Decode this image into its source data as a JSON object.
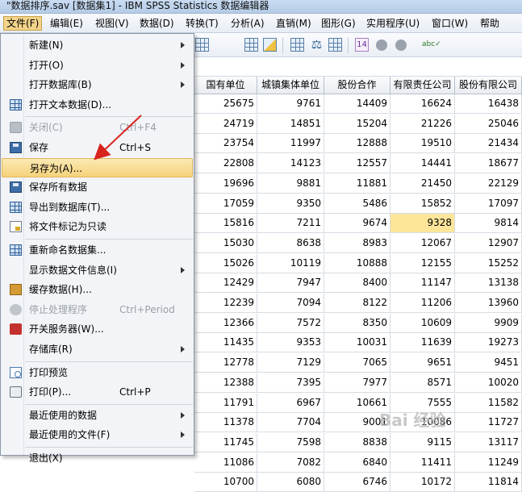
{
  "window": {
    "title": "\"数据排序.sav [数据集1] - IBM SPSS Statistics 数据编辑器"
  },
  "menubar": [
    {
      "label": "文件(F)",
      "active": true
    },
    {
      "label": "编辑(E)"
    },
    {
      "label": "视图(V)"
    },
    {
      "label": "数据(D)"
    },
    {
      "label": "转换(T)"
    },
    {
      "label": "分析(A)"
    },
    {
      "label": "直销(M)"
    },
    {
      "label": "图形(G)"
    },
    {
      "label": "实用程序(U)"
    },
    {
      "label": "窗口(W)"
    },
    {
      "label": "帮助"
    }
  ],
  "file_menu": [
    {
      "label": "新建(N)",
      "icon": "none",
      "submenu": true
    },
    {
      "label": "打开(O)",
      "icon": "none",
      "submenu": true
    },
    {
      "label": "打开数据库(B)",
      "icon": "none",
      "submenu": true
    },
    {
      "label": "打开文本数据(D)...",
      "icon": "text-data-icon"
    },
    {
      "sep": true
    },
    {
      "label": "关闭(C)",
      "shortcut": "Ctrl+F4",
      "icon": "close-data-icon",
      "disabled": true
    },
    {
      "label": "保存",
      "shortcut": "Ctrl+S",
      "icon": "save-icon"
    },
    {
      "label": "另存为(A)...",
      "icon": "none",
      "selected": true
    },
    {
      "label": "保存所有数据",
      "icon": "save-all-icon"
    },
    {
      "label": "导出到数据库(T)...",
      "icon": "export-database-icon"
    },
    {
      "label": "将文件标记为只读",
      "icon": "read-only-icon"
    },
    {
      "sep": true
    },
    {
      "label": "重新命名数据集...",
      "icon": "rename-dataset-icon"
    },
    {
      "label": "显示数据文件信息(I)",
      "icon": "none",
      "submenu": true
    },
    {
      "label": "缓存数据(H)...",
      "icon": "cache-data-icon"
    },
    {
      "label": "停止处理程序",
      "shortcut": "Ctrl+Period",
      "icon": "stop-processor-icon",
      "disabled": true
    },
    {
      "label": "开关服务器(W)...",
      "icon": "server-icon"
    },
    {
      "label": "存储库(R)",
      "icon": "none",
      "submenu": true
    },
    {
      "sep": true
    },
    {
      "label": "打印预览",
      "icon": "print-preview-icon"
    },
    {
      "label": "打印(P)...",
      "shortcut": "Ctrl+P",
      "icon": "print-icon"
    },
    {
      "sep": true
    },
    {
      "label": "最近使用的数据",
      "icon": "none",
      "submenu": true
    },
    {
      "label": "最近使用的文件(F)",
      "icon": "none",
      "submenu": true
    },
    {
      "sep": true
    },
    {
      "label": "退出(X)",
      "icon": "none"
    }
  ],
  "table": {
    "columns": [
      "国有单位",
      "城镇集体单位",
      "股份合作",
      "有限责任公司",
      "股份有限公司"
    ],
    "rows": [
      [
        "25675",
        "9761",
        "14409",
        "16624",
        "16438"
      ],
      [
        "24719",
        "14851",
        "15204",
        "21226",
        "25046"
      ],
      [
        "23754",
        "11997",
        "12888",
        "19510",
        "21434"
      ],
      [
        "22808",
        "14123",
        "12557",
        "14441",
        "18677"
      ],
      [
        "19696",
        "9881",
        "11881",
        "21450",
        "22129"
      ],
      [
        "17059",
        "9350",
        "5486",
        "15852",
        "17097"
      ],
      [
        "15816",
        "7211",
        "9674",
        "9328",
        "9814"
      ],
      [
        "15030",
        "8638",
        "8983",
        "12067",
        "12907"
      ],
      [
        "15026",
        "10119",
        "10888",
        "12155",
        "15252"
      ],
      [
        "12429",
        "7947",
        "8400",
        "11147",
        "13138"
      ],
      [
        "12239",
        "7094",
        "8122",
        "11206",
        "13960"
      ],
      [
        "12366",
        "7572",
        "8350",
        "10609",
        "9909"
      ],
      [
        "11435",
        "9353",
        "10031",
        "11639",
        "19273"
      ],
      [
        "12778",
        "7129",
        "7065",
        "9651",
        "9451"
      ],
      [
        "12388",
        "7395",
        "7977",
        "8571",
        "10020"
      ],
      [
        "11791",
        "6967",
        "10661",
        "7555",
        "11582"
      ],
      [
        "11378",
        "7704",
        "9001",
        "10086",
        "11727"
      ],
      [
        "11745",
        "7598",
        "8838",
        "9115",
        "13117"
      ],
      [
        "11086",
        "7082",
        "6840",
        "11411",
        "11249"
      ],
      [
        "10700",
        "6080",
        "6746",
        "10172",
        "11814"
      ]
    ],
    "highlighted_cell": {
      "row": 6,
      "col": 3
    }
  },
  "watermark": "Bai 经验"
}
